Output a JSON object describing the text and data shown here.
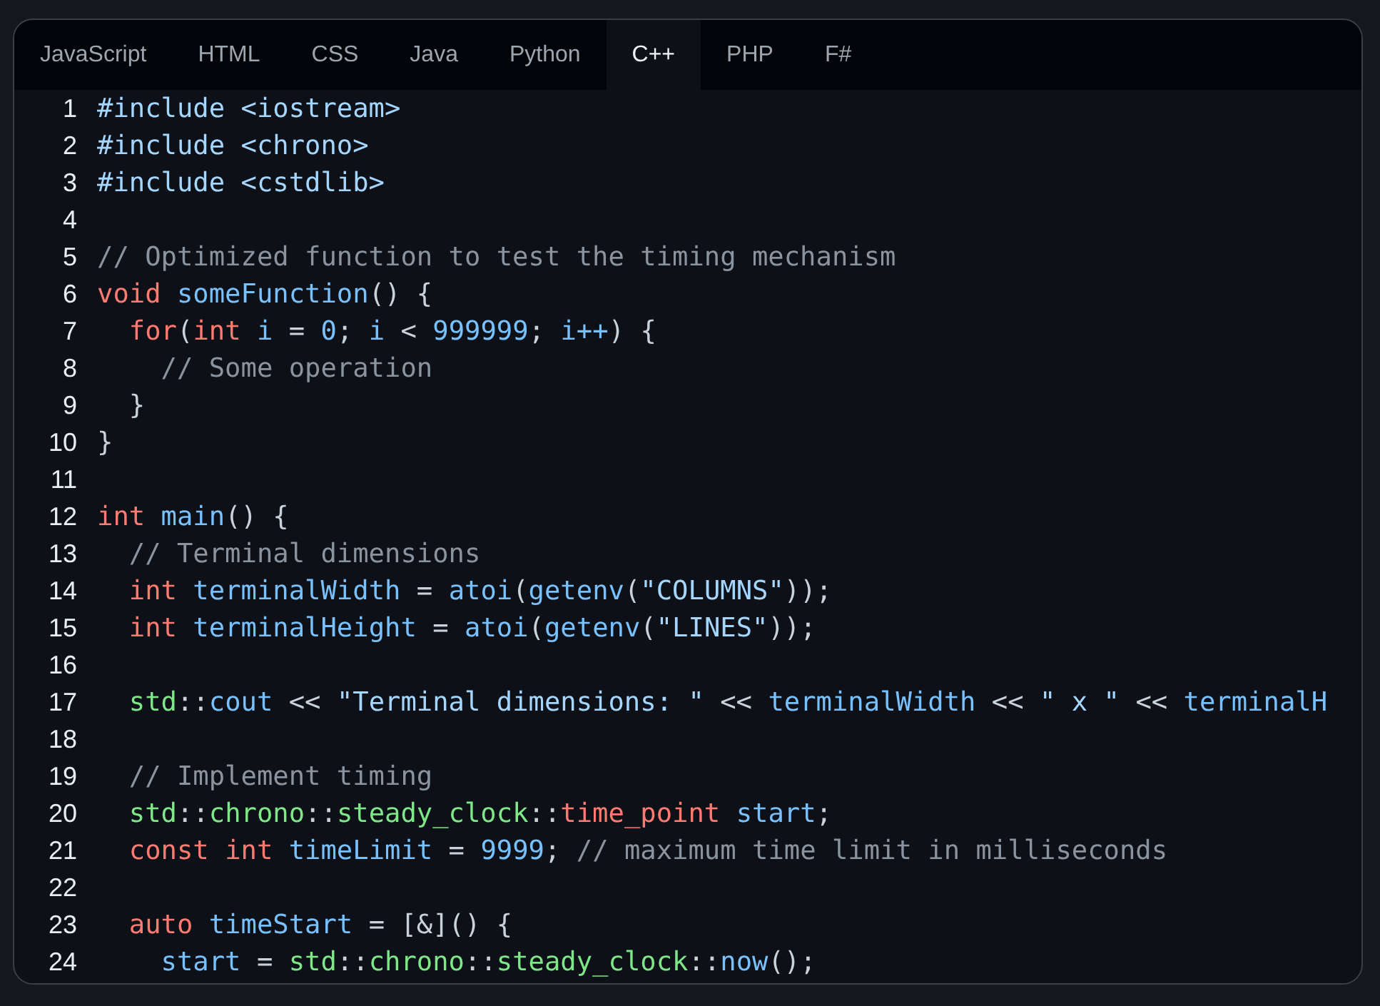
{
  "tabs": [
    {
      "label": "JavaScript",
      "selected": false
    },
    {
      "label": "HTML",
      "selected": false
    },
    {
      "label": "CSS",
      "selected": false
    },
    {
      "label": "Java",
      "selected": false
    },
    {
      "label": "Python",
      "selected": false
    },
    {
      "label": "C++",
      "selected": true
    },
    {
      "label": "PHP",
      "selected": false
    },
    {
      "label": "F#",
      "selected": false
    }
  ],
  "code_lines": [
    {
      "number": "1",
      "tokens": [
        {
          "kind": "str",
          "text": "#include <iostream>"
        }
      ]
    },
    {
      "number": "2",
      "tokens": [
        {
          "kind": "str",
          "text": "#include <chrono>"
        }
      ]
    },
    {
      "number": "3",
      "tokens": [
        {
          "kind": "str",
          "text": "#include <cstdlib>"
        }
      ]
    },
    {
      "number": "4"
    },
    {
      "number": "5",
      "tokens": [
        {
          "kind": "comment",
          "text": "// Optimized function to test the timing mechanism"
        }
      ]
    },
    {
      "number": "6",
      "tokens": [
        {
          "kind": "kw",
          "text": "void"
        },
        {
          "kind": "fn",
          "text": " someFunction"
        },
        {
          "kind": "plain",
          "text": "() {"
        }
      ]
    },
    {
      "number": "7",
      "tokens": [
        {
          "kind": "kw",
          "text": "  for"
        },
        {
          "kind": "plain",
          "text": "("
        },
        {
          "kind": "kw",
          "text": "int"
        },
        {
          "kind": "var",
          "text": " i"
        },
        {
          "kind": "plain",
          "text": " = "
        },
        {
          "kind": "num",
          "text": "0"
        },
        {
          "kind": "plain",
          "text": "; "
        },
        {
          "kind": "var",
          "text": "i"
        },
        {
          "kind": "plain",
          "text": " < "
        },
        {
          "kind": "num",
          "text": "999999"
        },
        {
          "kind": "plain",
          "text": "; "
        },
        {
          "kind": "var",
          "text": "i++"
        },
        {
          "kind": "plain",
          "text": ") {"
        }
      ]
    },
    {
      "number": "8",
      "tokens": [
        {
          "kind": "comment",
          "text": "    // Some operation"
        }
      ]
    },
    {
      "number": "9",
      "tokens": [
        {
          "kind": "plain",
          "text": "  }"
        }
      ]
    },
    {
      "number": "10",
      "tokens": [
        {
          "kind": "plain",
          "text": "}"
        }
      ]
    },
    {
      "number": "11"
    },
    {
      "number": "12",
      "tokens": [
        {
          "kind": "kw",
          "text": "int"
        },
        {
          "kind": "fn",
          "text": " main"
        },
        {
          "kind": "plain",
          "text": "() {"
        }
      ]
    },
    {
      "number": "13",
      "tokens": [
        {
          "kind": "comment",
          "text": "  // Terminal dimensions"
        }
      ]
    },
    {
      "number": "14",
      "tokens": [
        {
          "kind": "kw",
          "text": "  int"
        },
        {
          "kind": "var",
          "text": " terminalWidth"
        },
        {
          "kind": "plain",
          "text": " = "
        },
        {
          "kind": "fn",
          "text": "atoi"
        },
        {
          "kind": "plain",
          "text": "("
        },
        {
          "kind": "fn",
          "text": "getenv"
        },
        {
          "kind": "plain",
          "text": "("
        },
        {
          "kind": "str",
          "text": "\"COLUMNS\""
        },
        {
          "kind": "plain",
          "text": "));"
        }
      ]
    },
    {
      "number": "15",
      "tokens": [
        {
          "kind": "kw",
          "text": "  int"
        },
        {
          "kind": "var",
          "text": " terminalHeight"
        },
        {
          "kind": "plain",
          "text": " = "
        },
        {
          "kind": "fn",
          "text": "atoi"
        },
        {
          "kind": "plain",
          "text": "("
        },
        {
          "kind": "fn",
          "text": "getenv"
        },
        {
          "kind": "plain",
          "text": "("
        },
        {
          "kind": "str",
          "text": "\"LINES\""
        },
        {
          "kind": "plain",
          "text": "));"
        }
      ]
    },
    {
      "number": "16"
    },
    {
      "number": "17",
      "tokens": [
        {
          "kind": "ns",
          "text": "  std"
        },
        {
          "kind": "plain",
          "text": "::"
        },
        {
          "kind": "fn",
          "text": "cout"
        },
        {
          "kind": "plain",
          "text": " << "
        },
        {
          "kind": "str",
          "text": "\"Terminal dimensions: \""
        },
        {
          "kind": "plain",
          "text": " << "
        },
        {
          "kind": "var",
          "text": "terminalWidth"
        },
        {
          "kind": "plain",
          "text": " << "
        },
        {
          "kind": "str",
          "text": "\" x \""
        },
        {
          "kind": "plain",
          "text": " << "
        },
        {
          "kind": "var",
          "text": "terminalH"
        }
      ]
    },
    {
      "number": "18"
    },
    {
      "number": "19",
      "tokens": [
        {
          "kind": "comment",
          "text": "  // Implement timing"
        }
      ]
    },
    {
      "number": "20",
      "tokens": [
        {
          "kind": "ns",
          "text": "  std"
        },
        {
          "kind": "plain",
          "text": "::"
        },
        {
          "kind": "ns",
          "text": "chrono"
        },
        {
          "kind": "plain",
          "text": "::"
        },
        {
          "kind": "ns",
          "text": "steady_clock"
        },
        {
          "kind": "plain",
          "text": "::"
        },
        {
          "kind": "kw",
          "text": "time_point"
        },
        {
          "kind": "var",
          "text": " start"
        },
        {
          "kind": "plain",
          "text": ";"
        }
      ]
    },
    {
      "number": "21",
      "tokens": [
        {
          "kind": "kw",
          "text": "  const"
        },
        {
          "kind": "kw",
          "text": " int"
        },
        {
          "kind": "var",
          "text": " timeLimit"
        },
        {
          "kind": "plain",
          "text": " = "
        },
        {
          "kind": "num",
          "text": "9999"
        },
        {
          "kind": "plain",
          "text": "; "
        },
        {
          "kind": "comment",
          "text": "// maximum time limit in milliseconds"
        }
      ]
    },
    {
      "number": "22"
    },
    {
      "number": "23",
      "tokens": [
        {
          "kind": "kw",
          "text": "  auto"
        },
        {
          "kind": "var",
          "text": " timeStart"
        },
        {
          "kind": "plain",
          "text": " = [&]() {"
        }
      ]
    },
    {
      "number": "24",
      "tokens": [
        {
          "kind": "var",
          "text": "    start"
        },
        {
          "kind": "plain",
          "text": " = "
        },
        {
          "kind": "ns",
          "text": "std"
        },
        {
          "kind": "plain",
          "text": "::"
        },
        {
          "kind": "ns",
          "text": "chrono"
        },
        {
          "kind": "plain",
          "text": "::"
        },
        {
          "kind": "ns",
          "text": "steady_clock"
        },
        {
          "kind": "plain",
          "text": "::"
        },
        {
          "kind": "fn",
          "text": "now"
        },
        {
          "kind": "plain",
          "text": "();"
        }
      ]
    }
  ]
}
